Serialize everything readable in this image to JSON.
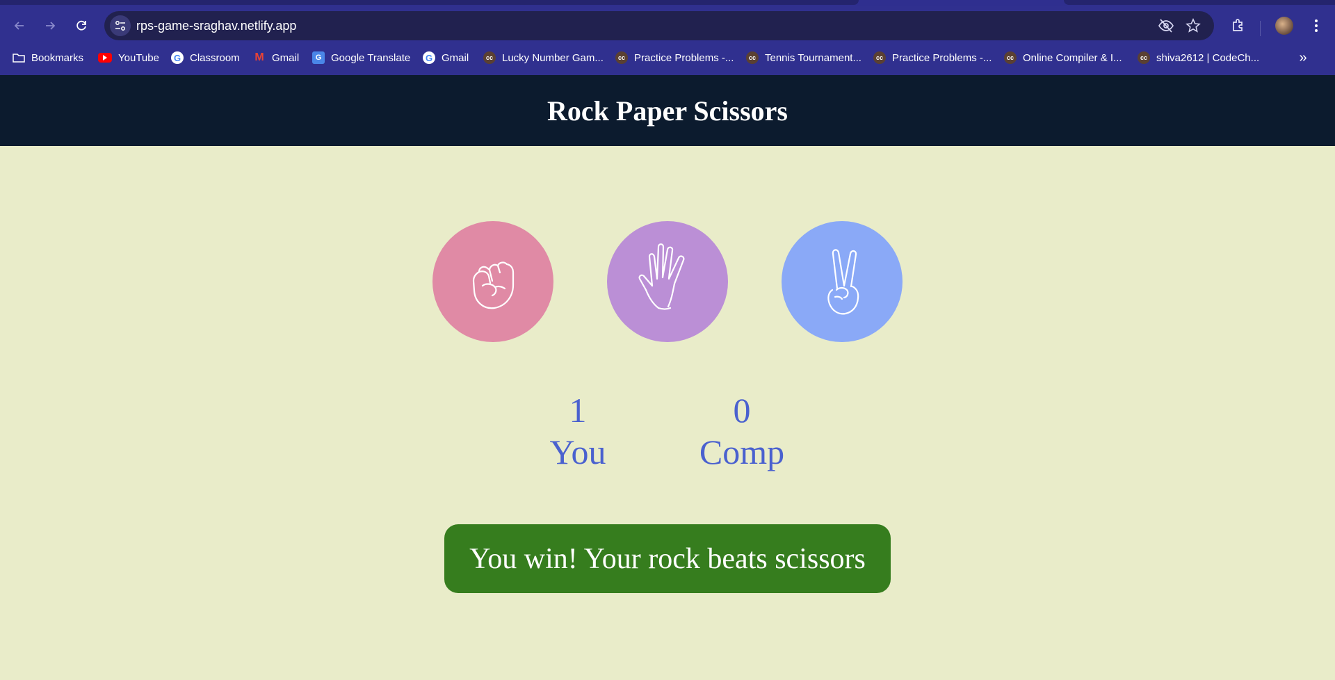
{
  "browser": {
    "url": "rps-game-sraghav.netlify.app",
    "bookmarks": [
      {
        "label": "Bookmarks",
        "icon": "folder-icon"
      },
      {
        "label": "YouTube",
        "icon": "youtube-icon"
      },
      {
        "label": "Classroom",
        "icon": "google-icon"
      },
      {
        "label": "Gmail",
        "icon": "gmail-icon"
      },
      {
        "label": "Google Translate",
        "icon": "google-translate-icon"
      },
      {
        "label": "Gmail",
        "icon": "google-icon"
      },
      {
        "label": "Lucky Number Gam...",
        "icon": "codechef-icon"
      },
      {
        "label": "Practice Problems -...",
        "icon": "codechef-icon"
      },
      {
        "label": "Tennis Tournament...",
        "icon": "codechef-icon"
      },
      {
        "label": "Practice Problems -...",
        "icon": "codechef-icon"
      },
      {
        "label": "Online Compiler & I...",
        "icon": "codechef-icon"
      },
      {
        "label": "shiva2612 | CodeCh...",
        "icon": "codechef-icon"
      }
    ]
  },
  "page": {
    "title": "Rock Paper Scissors",
    "choices": [
      {
        "name": "rock",
        "color": "#e08aa5",
        "icon": "fist-icon"
      },
      {
        "name": "paper",
        "color": "#bb8fd6",
        "icon": "open-hand-icon"
      },
      {
        "name": "scissors",
        "color": "#8aa9f7",
        "icon": "peace-hand-icon"
      }
    ],
    "score": {
      "you_value": "1",
      "you_label": "You",
      "comp_value": "0",
      "comp_label": "Comp"
    },
    "message": "You win! Your rock beats scissors",
    "message_color": "#367d1e",
    "header_color": "#0c1b2e",
    "background_color": "#e9ecc9"
  }
}
